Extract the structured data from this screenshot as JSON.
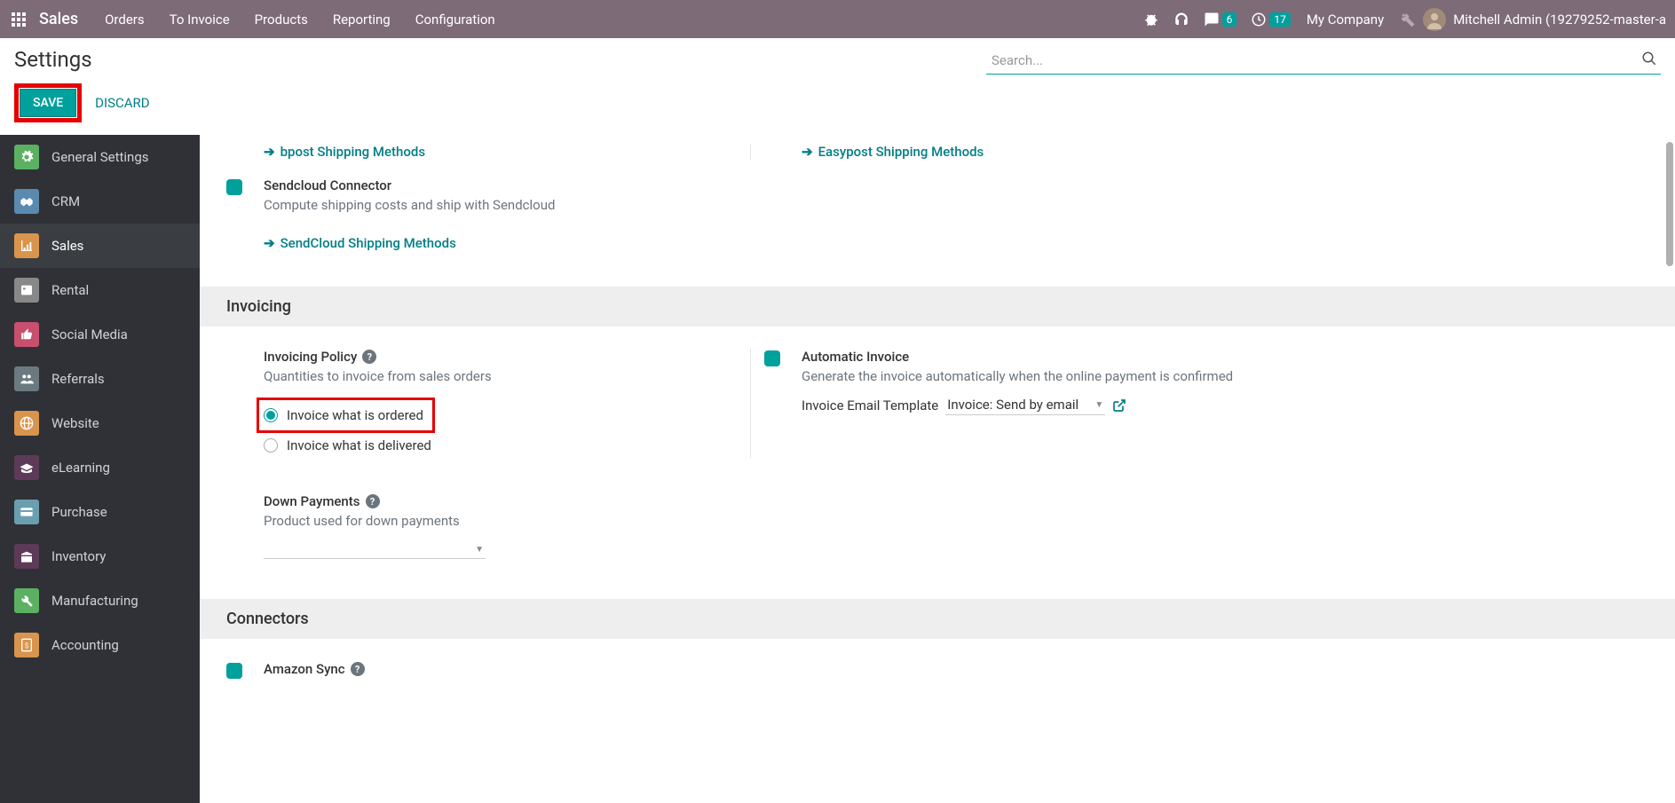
{
  "nav": {
    "brand": "Sales",
    "items": [
      "Orders",
      "To Invoice",
      "Products",
      "Reporting",
      "Configuration"
    ],
    "chat_badge": "6",
    "clock_badge": "17",
    "company": "My Company",
    "user": "Mitchell Admin (19279252-master-a"
  },
  "header": {
    "title": "Settings",
    "search_placeholder": "Search..."
  },
  "actions": {
    "save": "SAVE",
    "discard": "DISCARD"
  },
  "sidebar": {
    "items": [
      {
        "label": "General Settings"
      },
      {
        "label": "CRM"
      },
      {
        "label": "Sales"
      },
      {
        "label": "Rental"
      },
      {
        "label": "Social Media"
      },
      {
        "label": "Referrals"
      },
      {
        "label": "Website"
      },
      {
        "label": "eLearning"
      },
      {
        "label": "Purchase"
      },
      {
        "label": "Inventory"
      },
      {
        "label": "Manufacturing"
      },
      {
        "label": "Accounting"
      }
    ]
  },
  "links": {
    "bpost": "bpost Shipping Methods",
    "easypost": "Easypost Shipping Methods",
    "sendcloud": "SendCloud Shipping Methods"
  },
  "sendcloud": {
    "title": "Sendcloud Connector",
    "desc": "Compute shipping costs and ship with Sendcloud"
  },
  "sections": {
    "invoicing": "Invoicing",
    "connectors": "Connectors"
  },
  "invoicing_policy": {
    "title": "Invoicing Policy",
    "desc": "Quantities to invoice from sales orders",
    "opt1": "Invoice what is ordered",
    "opt2": "Invoice what is delivered"
  },
  "automatic_invoice": {
    "title": "Automatic Invoice",
    "desc": "Generate the invoice automatically when the online payment is confirmed",
    "field_label": "Invoice Email Template",
    "field_value": "Invoice: Send by email"
  },
  "down_payments": {
    "title": "Down Payments",
    "desc": "Product used for down payments"
  },
  "amazon": {
    "title": "Amazon Sync"
  }
}
